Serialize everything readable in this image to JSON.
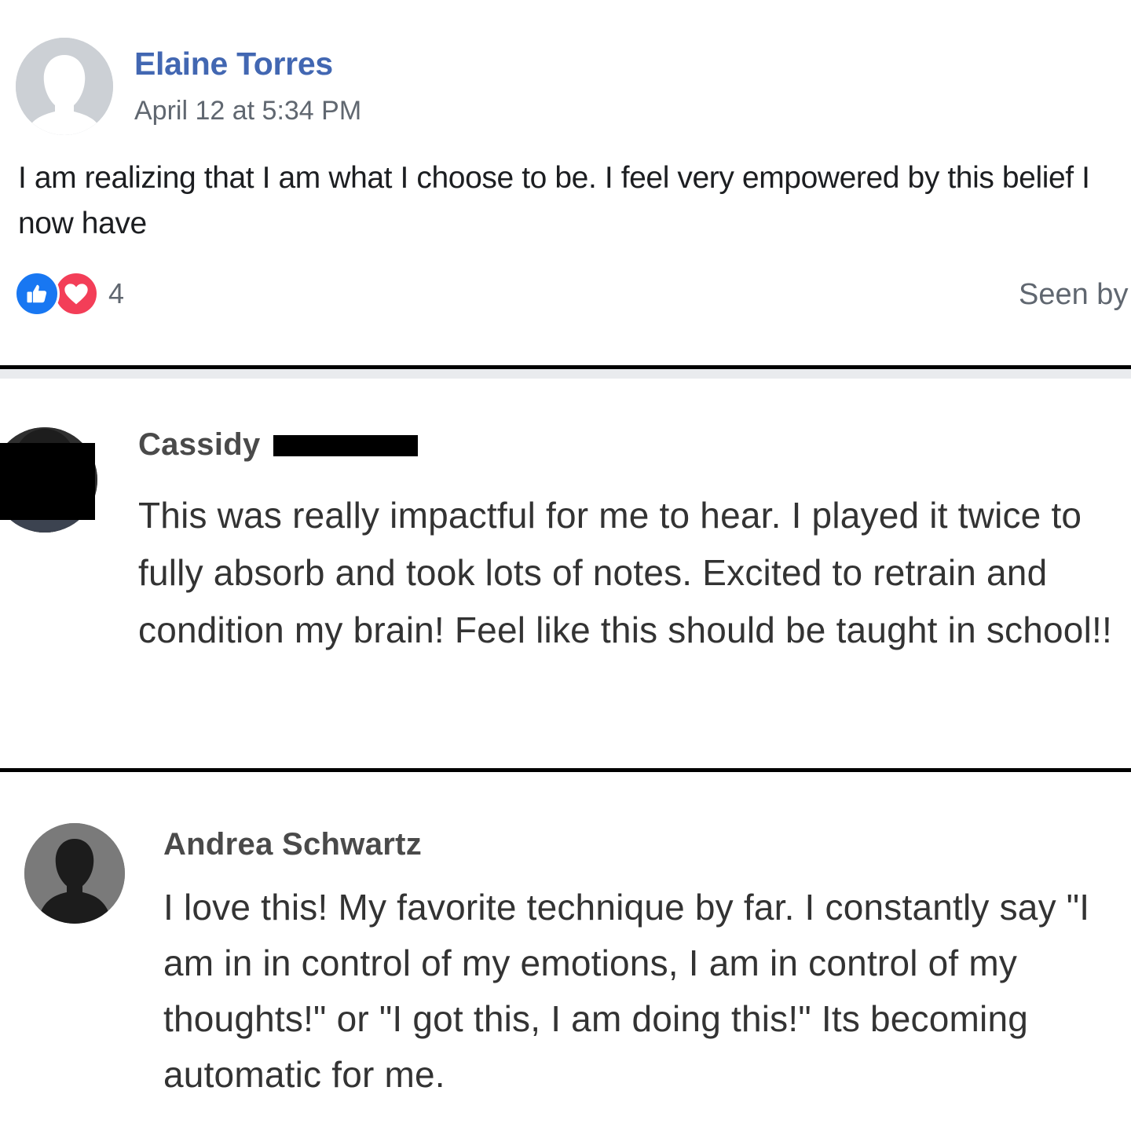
{
  "post": {
    "author": "Elaine Torres",
    "timestamp": "April 12 at 5:34 PM",
    "text": "I am realizing that I am what I choose to be. I feel very empowered by this belief I now have",
    "reaction_count": "4",
    "reactions": [
      "like-icon",
      "love-icon"
    ],
    "seen_by": "Seen by",
    "colors": {
      "author": "#4267b2",
      "like": "#1877f2",
      "love": "#f33e58"
    }
  },
  "comments": [
    {
      "author": "Cassidy",
      "text": "This was really impactful for me to hear. I played it twice to fully absorb and took lots of notes. Excited to retrain and condition my brain! Feel like this should be taught in school!!"
    },
    {
      "author": "Andrea Schwartz",
      "text": "I love this! My favorite technique by far. I constantly say \"I am in in control of my emotions, I am in control of my thoughts!\" or \"I got this, I am doing this!\" Its becoming automatic for me."
    }
  ]
}
